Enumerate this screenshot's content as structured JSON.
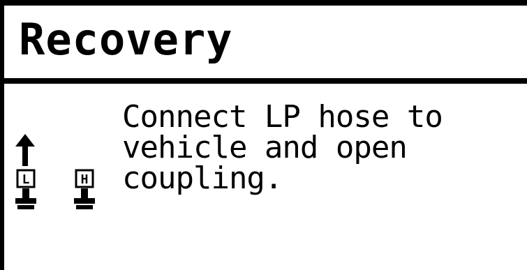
{
  "header": {
    "title": "Recovery"
  },
  "main": {
    "message": "Connect LP hose to\nvehicle and open\ncoupling."
  },
  "icons": {
    "arrow": "up-arrow-icon",
    "low_pressure": {
      "name": "low-pressure-coupling-icon",
      "label": "L"
    },
    "high_pressure": {
      "name": "high-pressure-coupling-icon",
      "label": "H"
    }
  },
  "colors": {
    "foreground": "#000000",
    "background": "#ffffff"
  }
}
